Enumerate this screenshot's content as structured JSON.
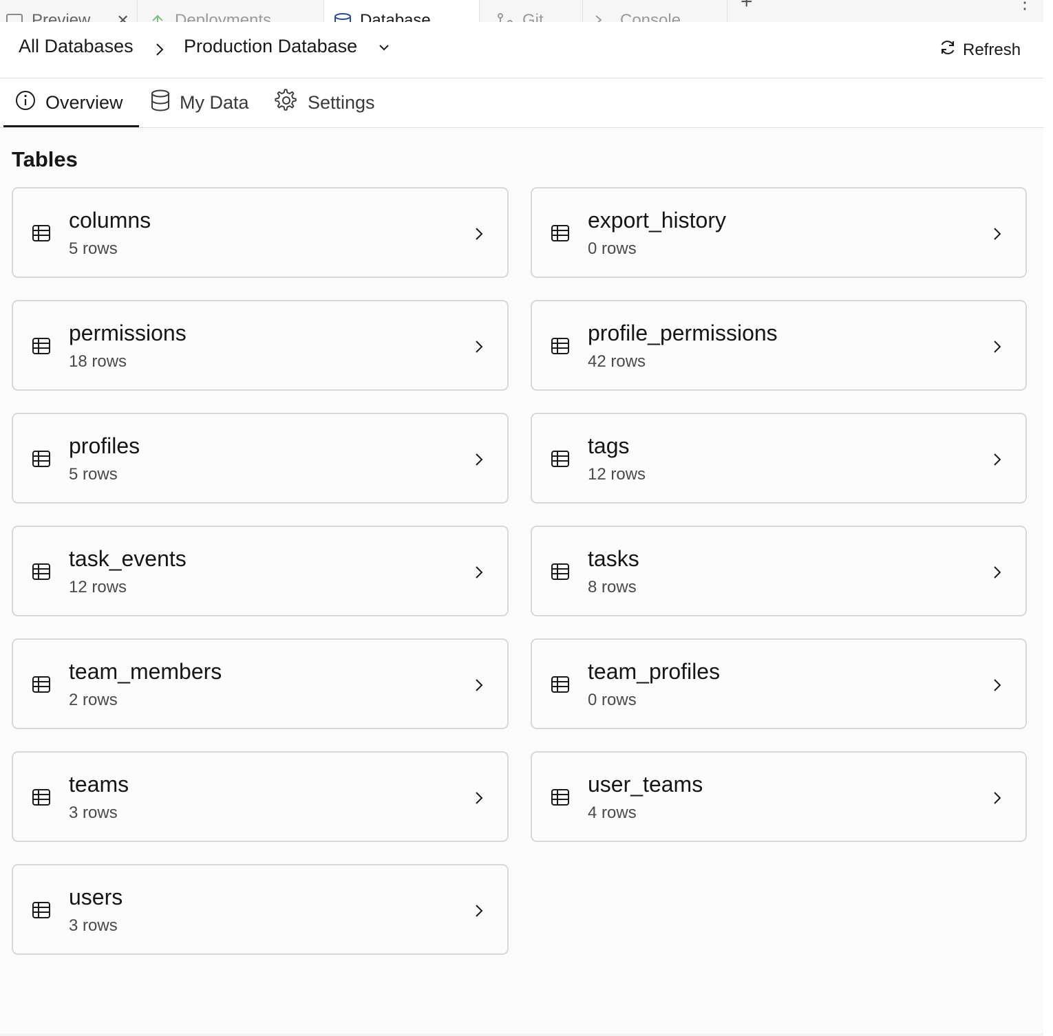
{
  "window_tabs": [
    {
      "label": "Preview",
      "icon": "monitor-icon",
      "closable": true
    },
    {
      "label": "Deployments",
      "icon": "deploy-icon"
    },
    {
      "label": "Database",
      "icon": "database-icon",
      "active": true
    },
    {
      "label": "Git",
      "icon": "git-icon"
    },
    {
      "label": "Console",
      "icon": "console-icon"
    }
  ],
  "header": {
    "crumb_root": "All Databases",
    "crumb_current": "Production Database",
    "refresh_label": "Refresh"
  },
  "subtabs": {
    "overview": "Overview",
    "my_data": "My Data",
    "settings": "Settings"
  },
  "section_title": "Tables",
  "tables": [
    {
      "name": "columns",
      "rows": "5 rows"
    },
    {
      "name": "export_history",
      "rows": "0 rows"
    },
    {
      "name": "permissions",
      "rows": "18 rows"
    },
    {
      "name": "profile_permissions",
      "rows": "42 rows"
    },
    {
      "name": "profiles",
      "rows": "5 rows"
    },
    {
      "name": "tags",
      "rows": "12 rows"
    },
    {
      "name": "task_events",
      "rows": "12 rows"
    },
    {
      "name": "tasks",
      "rows": "8 rows"
    },
    {
      "name": "team_members",
      "rows": "2 rows"
    },
    {
      "name": "team_profiles",
      "rows": "0 rows"
    },
    {
      "name": "teams",
      "rows": "3 rows"
    },
    {
      "name": "user_teams",
      "rows": "4 rows"
    },
    {
      "name": "users",
      "rows": "3 rows"
    }
  ]
}
